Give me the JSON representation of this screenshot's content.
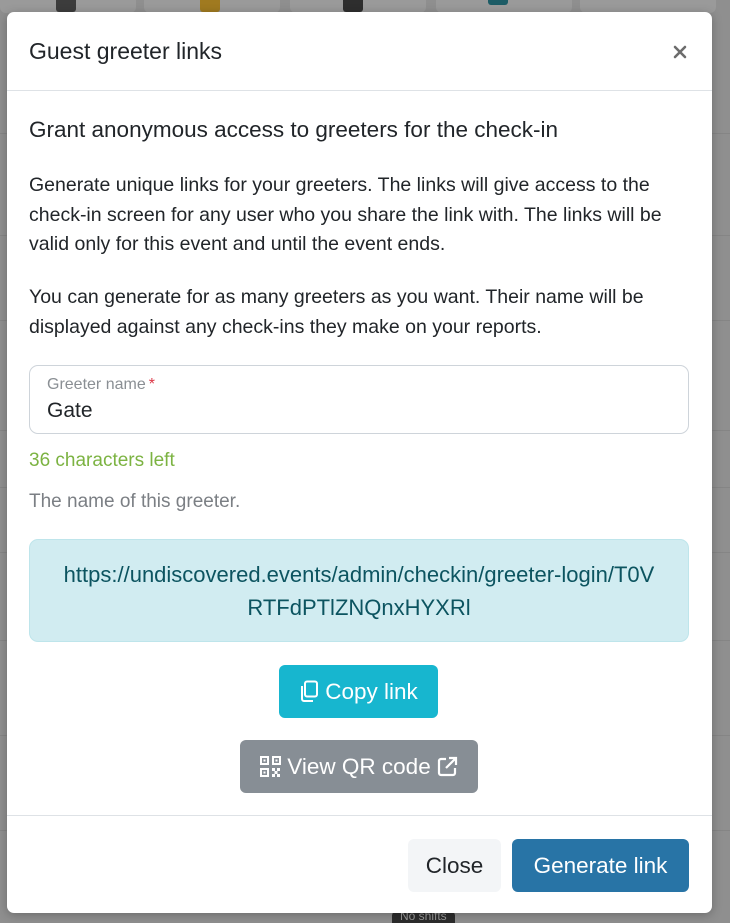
{
  "modal": {
    "title": "Guest greeter links",
    "heading": "Grant anonymous access to greeters for the check-in",
    "paragraph_1": "Generate unique links for your greeters. The links will give access to the check-in screen for any user who you share the link with. The links will be valid only for this event and until the event ends.",
    "paragraph_2": "You can generate for as many greeters as you want. Their name will be displayed against any check-ins they make on your reports.",
    "field": {
      "label": "Greeter name",
      "required_mark": "*",
      "value": "Gate",
      "chars_left": "36 characters left",
      "hint": "The name of this greeter."
    },
    "generated_link": "https://undiscovered.events/admin/checkin/greeter-login/T0VRTFdPTlZNQnxHYXRl",
    "copy_button": "Copy link",
    "qr_button": "View QR code",
    "footer": {
      "close_button": "Close",
      "generate_button": "Generate link"
    }
  },
  "background": {
    "badge": "No shifts"
  },
  "colors": {
    "primary": "#2874a6",
    "info": "#17b6cf",
    "secondary": "#878e95",
    "success_text": "#7cb342",
    "alert_info_bg": "#d1ecf1",
    "alert_info_text": "#0c5460",
    "required": "#dc3545"
  }
}
